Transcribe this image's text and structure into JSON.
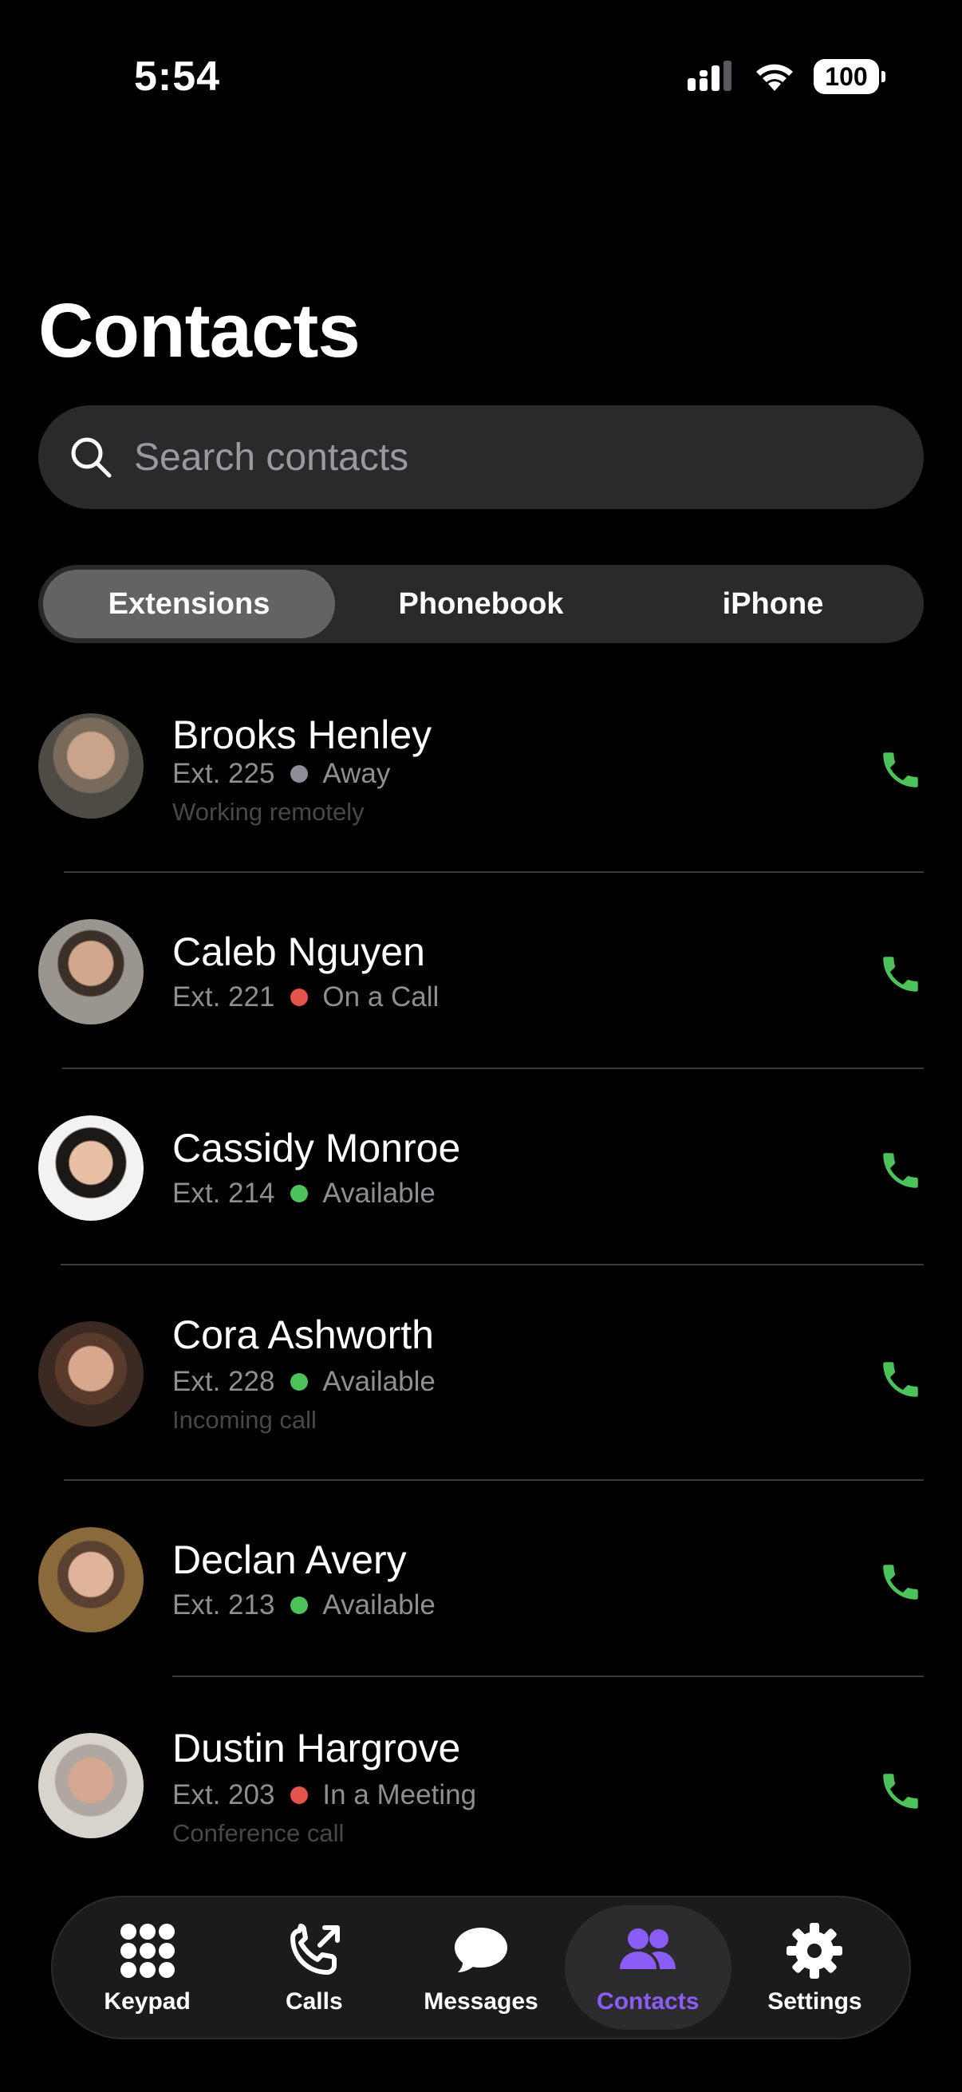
{
  "status_bar": {
    "time": "5:54",
    "battery": "100"
  },
  "page_title": "Contacts",
  "search": {
    "placeholder": "Search contacts",
    "value": ""
  },
  "segments": [
    {
      "label": "Extensions",
      "active": true
    },
    {
      "label": "Phonebook",
      "active": false
    },
    {
      "label": "iPhone",
      "active": false
    }
  ],
  "contacts": [
    {
      "name": "Brooks Henley",
      "ext": "Ext. 225",
      "status": "Away",
      "status_color": "#8e8e99",
      "note": "Working remotely"
    },
    {
      "name": "Caleb Nguyen",
      "ext": "Ext. 221",
      "status": "On a Call",
      "status_color": "#e5534b",
      "note": ""
    },
    {
      "name": "Cassidy Monroe",
      "ext": "Ext. 214",
      "status": "Available",
      "status_color": "#4cc35a",
      "note": ""
    },
    {
      "name": "Cora Ashworth",
      "ext": "Ext. 228",
      "status": "Available",
      "status_color": "#4cc35a",
      "note": "Incoming call"
    },
    {
      "name": "Declan Avery",
      "ext": "Ext. 213",
      "status": "Available",
      "status_color": "#4cc35a",
      "note": ""
    },
    {
      "name": "Dustin Hargrove",
      "ext": "Ext. 203",
      "status": "In a Meeting",
      "status_color": "#e5534b",
      "note": "Conference call"
    }
  ],
  "tabs": [
    {
      "label": "Keypad",
      "icon": "keypad-icon",
      "active": false
    },
    {
      "label": "Calls",
      "icon": "outgoing-call-icon",
      "active": false
    },
    {
      "label": "Messages",
      "icon": "message-bubble-icon",
      "active": false
    },
    {
      "label": "Contacts",
      "icon": "contacts-icon",
      "active": true
    },
    {
      "label": "Settings",
      "icon": "gear-icon",
      "active": false
    }
  ],
  "colors": {
    "accent": "#8b5cf6",
    "call_green": "#4cc35a",
    "background": "#000000"
  }
}
